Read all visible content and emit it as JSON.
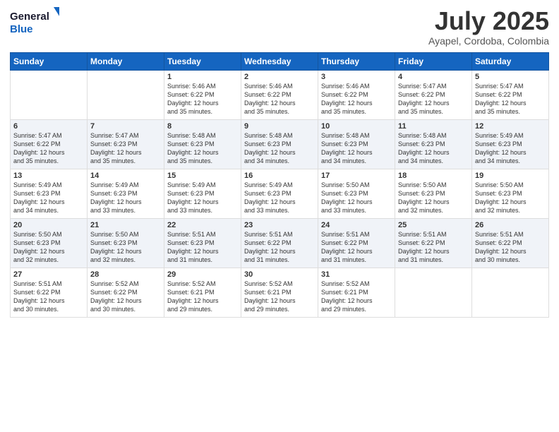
{
  "logo": {
    "line1": "General",
    "line2": "Blue"
  },
  "title": "July 2025",
  "subtitle": "Ayapel, Cordoba, Colombia",
  "weekdays": [
    "Sunday",
    "Monday",
    "Tuesday",
    "Wednesday",
    "Thursday",
    "Friday",
    "Saturday"
  ],
  "weeks": [
    [
      {
        "day": "",
        "info": ""
      },
      {
        "day": "",
        "info": ""
      },
      {
        "day": "1",
        "info": "Sunrise: 5:46 AM\nSunset: 6:22 PM\nDaylight: 12 hours\nand 35 minutes."
      },
      {
        "day": "2",
        "info": "Sunrise: 5:46 AM\nSunset: 6:22 PM\nDaylight: 12 hours\nand 35 minutes."
      },
      {
        "day": "3",
        "info": "Sunrise: 5:46 AM\nSunset: 6:22 PM\nDaylight: 12 hours\nand 35 minutes."
      },
      {
        "day": "4",
        "info": "Sunrise: 5:47 AM\nSunset: 6:22 PM\nDaylight: 12 hours\nand 35 minutes."
      },
      {
        "day": "5",
        "info": "Sunrise: 5:47 AM\nSunset: 6:22 PM\nDaylight: 12 hours\nand 35 minutes."
      }
    ],
    [
      {
        "day": "6",
        "info": "Sunrise: 5:47 AM\nSunset: 6:22 PM\nDaylight: 12 hours\nand 35 minutes."
      },
      {
        "day": "7",
        "info": "Sunrise: 5:47 AM\nSunset: 6:23 PM\nDaylight: 12 hours\nand 35 minutes."
      },
      {
        "day": "8",
        "info": "Sunrise: 5:48 AM\nSunset: 6:23 PM\nDaylight: 12 hours\nand 35 minutes."
      },
      {
        "day": "9",
        "info": "Sunrise: 5:48 AM\nSunset: 6:23 PM\nDaylight: 12 hours\nand 34 minutes."
      },
      {
        "day": "10",
        "info": "Sunrise: 5:48 AM\nSunset: 6:23 PM\nDaylight: 12 hours\nand 34 minutes."
      },
      {
        "day": "11",
        "info": "Sunrise: 5:48 AM\nSunset: 6:23 PM\nDaylight: 12 hours\nand 34 minutes."
      },
      {
        "day": "12",
        "info": "Sunrise: 5:49 AM\nSunset: 6:23 PM\nDaylight: 12 hours\nand 34 minutes."
      }
    ],
    [
      {
        "day": "13",
        "info": "Sunrise: 5:49 AM\nSunset: 6:23 PM\nDaylight: 12 hours\nand 34 minutes."
      },
      {
        "day": "14",
        "info": "Sunrise: 5:49 AM\nSunset: 6:23 PM\nDaylight: 12 hours\nand 33 minutes."
      },
      {
        "day": "15",
        "info": "Sunrise: 5:49 AM\nSunset: 6:23 PM\nDaylight: 12 hours\nand 33 minutes."
      },
      {
        "day": "16",
        "info": "Sunrise: 5:49 AM\nSunset: 6:23 PM\nDaylight: 12 hours\nand 33 minutes."
      },
      {
        "day": "17",
        "info": "Sunrise: 5:50 AM\nSunset: 6:23 PM\nDaylight: 12 hours\nand 33 minutes."
      },
      {
        "day": "18",
        "info": "Sunrise: 5:50 AM\nSunset: 6:23 PM\nDaylight: 12 hours\nand 32 minutes."
      },
      {
        "day": "19",
        "info": "Sunrise: 5:50 AM\nSunset: 6:23 PM\nDaylight: 12 hours\nand 32 minutes."
      }
    ],
    [
      {
        "day": "20",
        "info": "Sunrise: 5:50 AM\nSunset: 6:23 PM\nDaylight: 12 hours\nand 32 minutes."
      },
      {
        "day": "21",
        "info": "Sunrise: 5:50 AM\nSunset: 6:23 PM\nDaylight: 12 hours\nand 32 minutes."
      },
      {
        "day": "22",
        "info": "Sunrise: 5:51 AM\nSunset: 6:23 PM\nDaylight: 12 hours\nand 31 minutes."
      },
      {
        "day": "23",
        "info": "Sunrise: 5:51 AM\nSunset: 6:22 PM\nDaylight: 12 hours\nand 31 minutes."
      },
      {
        "day": "24",
        "info": "Sunrise: 5:51 AM\nSunset: 6:22 PM\nDaylight: 12 hours\nand 31 minutes."
      },
      {
        "day": "25",
        "info": "Sunrise: 5:51 AM\nSunset: 6:22 PM\nDaylight: 12 hours\nand 31 minutes."
      },
      {
        "day": "26",
        "info": "Sunrise: 5:51 AM\nSunset: 6:22 PM\nDaylight: 12 hours\nand 30 minutes."
      }
    ],
    [
      {
        "day": "27",
        "info": "Sunrise: 5:51 AM\nSunset: 6:22 PM\nDaylight: 12 hours\nand 30 minutes."
      },
      {
        "day": "28",
        "info": "Sunrise: 5:52 AM\nSunset: 6:22 PM\nDaylight: 12 hours\nand 30 minutes."
      },
      {
        "day": "29",
        "info": "Sunrise: 5:52 AM\nSunset: 6:21 PM\nDaylight: 12 hours\nand 29 minutes."
      },
      {
        "day": "30",
        "info": "Sunrise: 5:52 AM\nSunset: 6:21 PM\nDaylight: 12 hours\nand 29 minutes."
      },
      {
        "day": "31",
        "info": "Sunrise: 5:52 AM\nSunset: 6:21 PM\nDaylight: 12 hours\nand 29 minutes."
      },
      {
        "day": "",
        "info": ""
      },
      {
        "day": "",
        "info": ""
      }
    ]
  ]
}
